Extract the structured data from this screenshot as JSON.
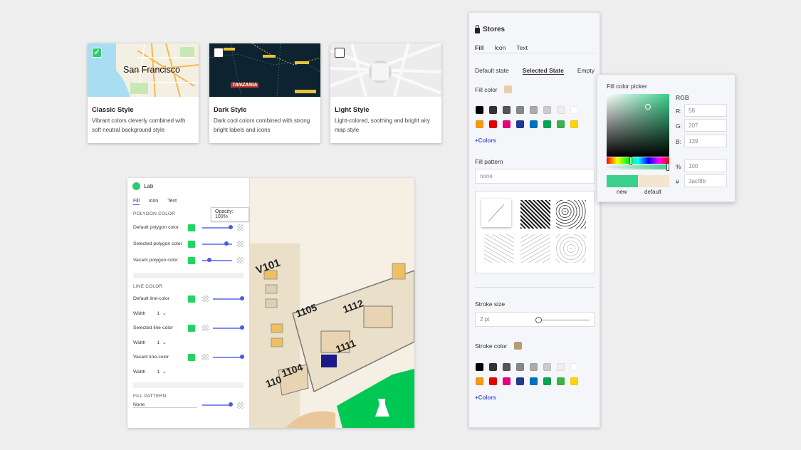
{
  "styles": [
    {
      "title": "Classic Style",
      "desc": "Vibrant colors cleverly combined with soft neutral background style",
      "checked": true,
      "map_label": "San Francisco"
    },
    {
      "title": "Dark Style",
      "desc": "Dark cool colors combined with strong bright labels and icons",
      "checked": false,
      "map_label": "TANZANIA"
    },
    {
      "title": "Light Style",
      "desc": "Light-colored, soothing and bright airy map style",
      "checked": false
    }
  ],
  "lab": {
    "name": "Lab",
    "tabs": [
      "Fill",
      "Icon",
      "Text"
    ],
    "polygon_section": "POLYGON COLOR",
    "tooltip": "Opacity: 100%",
    "polygon_rows": [
      "Default polygon color",
      "Selected polygon color",
      "Vacant polygon color"
    ],
    "line_section": "LINE COLOR",
    "line_rows": [
      "Default line-color",
      "Selected line-color",
      "Vacant line-color"
    ],
    "width_label": "Width",
    "width_value": "1",
    "fill_section": "FILL PATTERN",
    "fill_value": "None",
    "map_labels": [
      "V101",
      "1105",
      "1112",
      "1111",
      "1104",
      "110"
    ]
  },
  "stores": {
    "title": "Stores",
    "tabs": [
      "Fill",
      "Icon",
      "Text"
    ],
    "states": [
      "Default state",
      "Selected State",
      "Empty"
    ],
    "fill_color_label": "Fill color",
    "fill_color": "#e6cfae",
    "palette": [
      "#000000",
      "#333333",
      "#555555",
      "#888888",
      "#aaaaaa",
      "#cccccc",
      "#eeeeee",
      "#ffffff",
      "#f39c12",
      "#e60000",
      "#e6007e",
      "#1f3a93",
      "#0070c0",
      "#00a651",
      "#3cb44b",
      "#ffd700"
    ],
    "colors_link": "+Colors",
    "fill_pattern_label": "Fill pattern",
    "fill_pattern_value": "none",
    "stroke_size_label": "Stroke size",
    "stroke_size_value": "2 pt",
    "stroke_color_label": "Stroke color",
    "stroke_color": "#b89a74"
  },
  "picker": {
    "title": "Fill color picker",
    "mode": "RGB",
    "r_label": "R:",
    "r": "58",
    "g_label": "G:",
    "g": "207",
    "b_label": "B:",
    "b": "139",
    "alpha_label": "%",
    "alpha": "100",
    "hex_label": "#",
    "hex": "3acf8b",
    "new_label": "new",
    "default_label": "default"
  }
}
